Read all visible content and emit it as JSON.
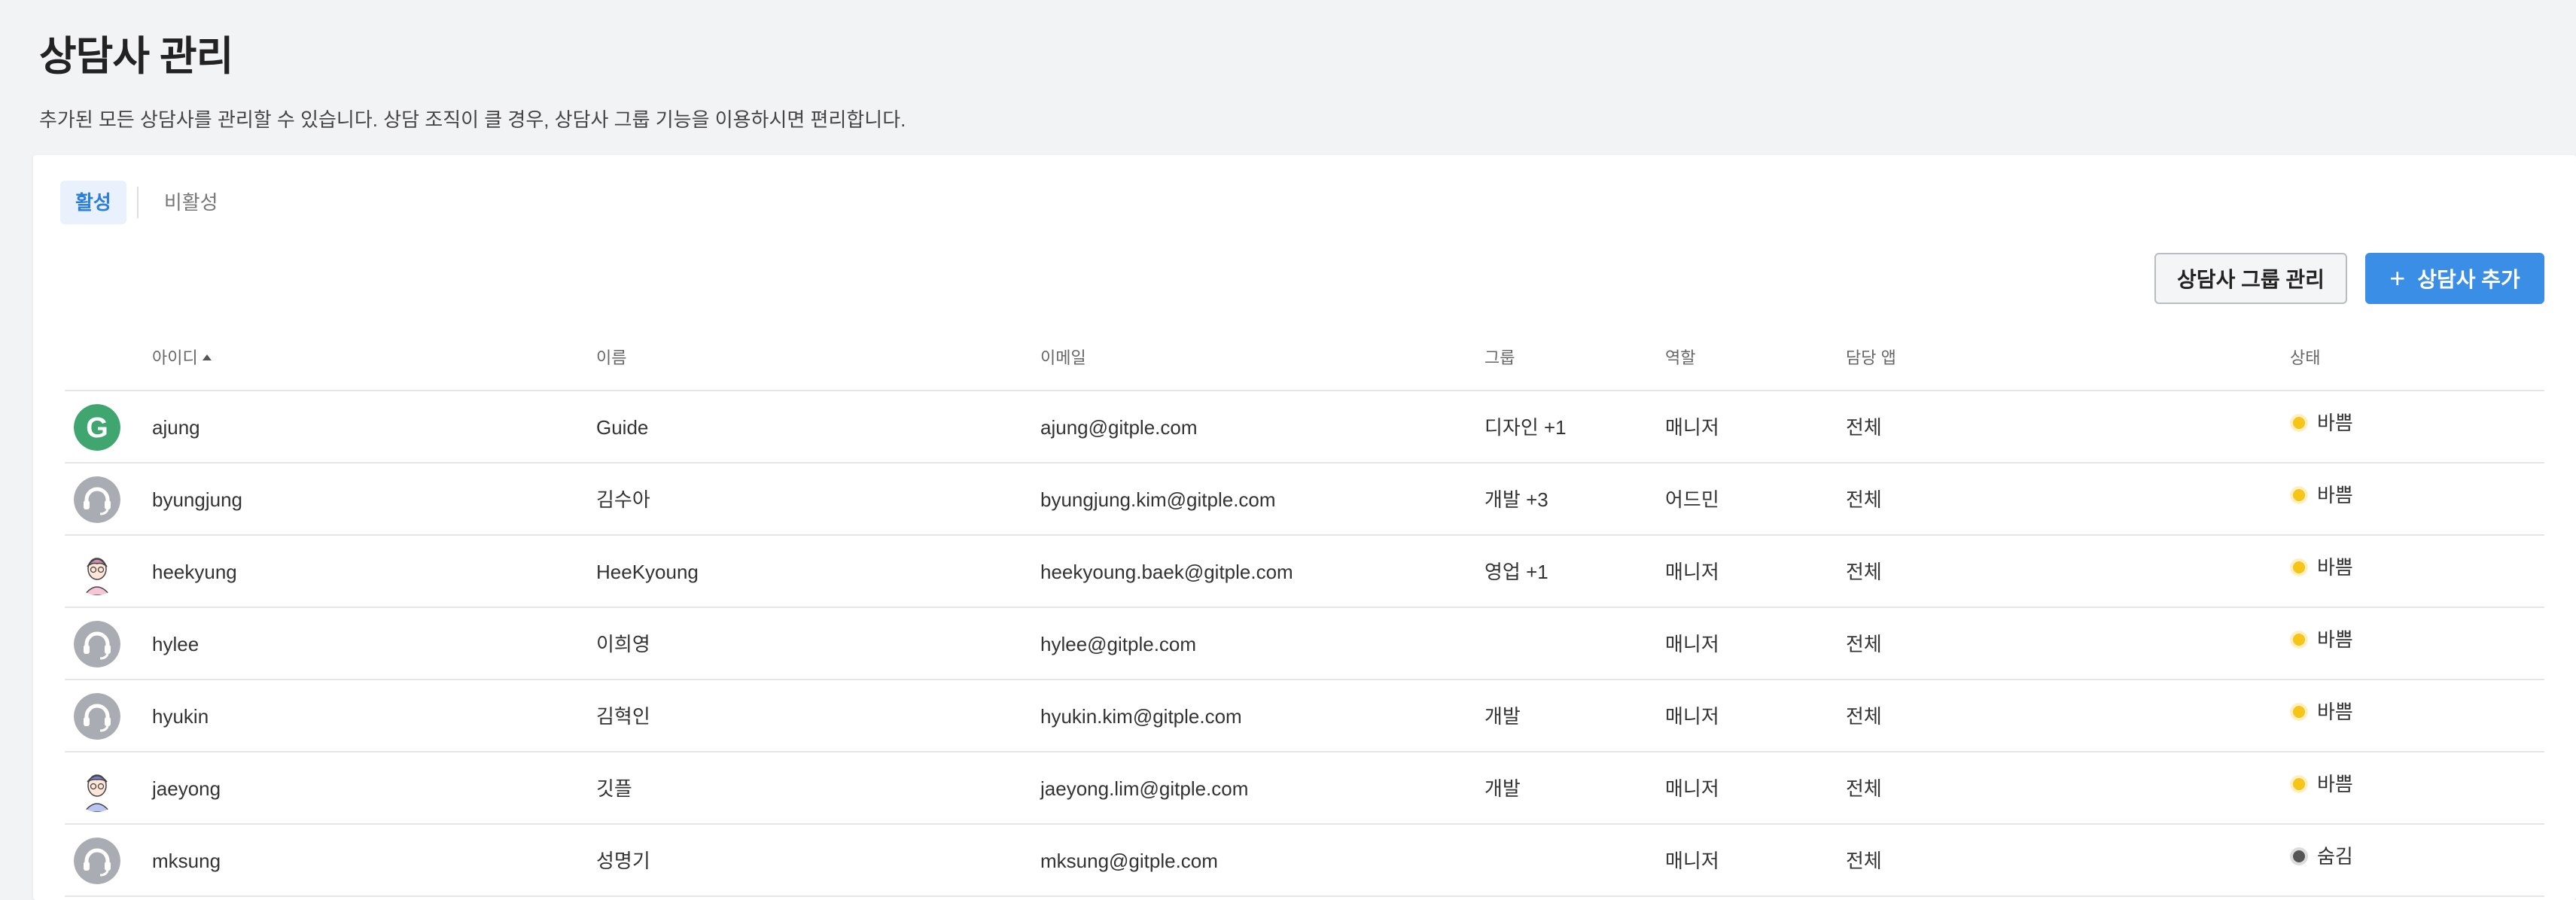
{
  "header": {
    "title": "상담사 관리",
    "description": "추가된 모든 상담사를 관리할 수 있습니다. 상담 조직이 클 경우, 상담사 그룹 기능을 이용하시면 편리합니다."
  },
  "tabs": [
    {
      "label": "활성",
      "active": true
    },
    {
      "label": "비활성",
      "active": false
    }
  ],
  "toolbar": {
    "group_manage_label": "상담사 그룹 관리",
    "add_label": "상담사 추가",
    "add_icon": "plus-icon"
  },
  "table": {
    "columns": {
      "id": "아이디",
      "name": "이름",
      "email": "이메일",
      "group": "그룹",
      "role": "역할",
      "app": "담당 앱",
      "status": "상태"
    },
    "sort": {
      "column": "id",
      "direction": "asc"
    },
    "rows": [
      {
        "avatar": "guide-logo",
        "id": "ajung",
        "name": "Guide",
        "email": "ajung@gitple.com",
        "group": "디자인 +1",
        "role": "매니저",
        "app": "전체",
        "status": "바쁨",
        "status_color": "#f5c518"
      },
      {
        "avatar": "headset-default",
        "id": "byungjung",
        "name": "김수아",
        "email": "byungjung.kim@gitple.com",
        "group": "개발 +3",
        "role": "어드민",
        "app": "전체",
        "status": "바쁨",
        "status_color": "#f5c518"
      },
      {
        "avatar": "person-pink",
        "id": "heekyung",
        "name": "HeeKyoung",
        "email": "heekyoung.baek@gitple.com",
        "group": "영업 +1",
        "role": "매니저",
        "app": "전체",
        "status": "바쁨",
        "status_color": "#f5c518"
      },
      {
        "avatar": "headset-default",
        "id": "hylee",
        "name": "이희영",
        "email": "hylee@gitple.com",
        "group": "",
        "role": "매니저",
        "app": "전체",
        "status": "바쁨",
        "status_color": "#f5c518"
      },
      {
        "avatar": "headset-default",
        "id": "hyukin",
        "name": "김혁인",
        "email": "hyukin.kim@gitple.com",
        "group": "개발",
        "role": "매니저",
        "app": "전체",
        "status": "바쁨",
        "status_color": "#f5c518"
      },
      {
        "avatar": "person-blue",
        "id": "jaeyong",
        "name": "깃플",
        "email": "jaeyong.lim@gitple.com",
        "group": "개발",
        "role": "매니저",
        "app": "전체",
        "status": "바쁨",
        "status_color": "#f5c518"
      },
      {
        "avatar": "headset-default",
        "id": "mksung",
        "name": "성명기",
        "email": "mksung@gitple.com",
        "group": "",
        "role": "매니저",
        "app": "전체",
        "status": "숨김",
        "status_color": "#555555"
      }
    ]
  },
  "colors": {
    "accent": "#3a8ee6",
    "busy": "#f5c518",
    "hidden": "#555555",
    "guide_green": "#3fa66f"
  }
}
